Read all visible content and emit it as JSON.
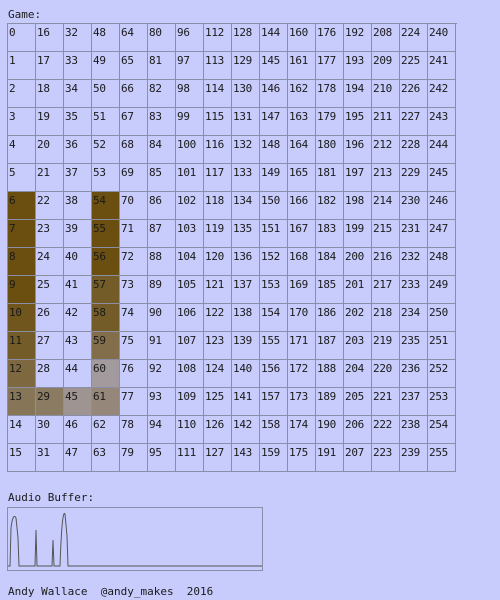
{
  "game": {
    "label": "Game:",
    "columns": 16,
    "rows": 16,
    "cells": [
      "0",
      "16",
      "32",
      "48",
      "64",
      "80",
      "96",
      "112",
      "128",
      "144",
      "160",
      "176",
      "192",
      "208",
      "224",
      "240",
      "1",
      "17",
      "33",
      "49",
      "65",
      "81",
      "97",
      "113",
      "129",
      "145",
      "161",
      "177",
      "193",
      "209",
      "225",
      "241",
      "2",
      "18",
      "34",
      "50",
      "66",
      "82",
      "98",
      "114",
      "130",
      "146",
      "162",
      "178",
      "194",
      "210",
      "226",
      "242",
      "3",
      "19",
      "35",
      "51",
      "67",
      "83",
      "99",
      "115",
      "131",
      "147",
      "163",
      "179",
      "195",
      "211",
      "227",
      "243",
      "4",
      "20",
      "36",
      "52",
      "68",
      "84",
      "100",
      "116",
      "132",
      "148",
      "164",
      "180",
      "196",
      "212",
      "228",
      "244",
      "5",
      "21",
      "37",
      "53",
      "69",
      "85",
      "101",
      "117",
      "133",
      "149",
      "165",
      "181",
      "197",
      "213",
      "229",
      "245",
      "6",
      "22",
      "38",
      "54",
      "70",
      "86",
      "102",
      "118",
      "134",
      "150",
      "166",
      "182",
      "198",
      "214",
      "230",
      "246",
      "7",
      "23",
      "39",
      "55",
      "71",
      "87",
      "103",
      "119",
      "135",
      "151",
      "167",
      "183",
      "199",
      "215",
      "231",
      "247",
      "8",
      "24",
      "40",
      "56",
      "72",
      "88",
      "104",
      "120",
      "136",
      "152",
      "168",
      "184",
      "200",
      "216",
      "232",
      "248",
      "9",
      "25",
      "41",
      "57",
      "73",
      "89",
      "105",
      "121",
      "137",
      "153",
      "169",
      "185",
      "201",
      "217",
      "233",
      "249",
      "10",
      "26",
      "42",
      "58",
      "74",
      "90",
      "106",
      "122",
      "138",
      "154",
      "170",
      "186",
      "202",
      "218",
      "234",
      "250",
      "11",
      "27",
      "43",
      "59",
      "75",
      "91",
      "107",
      "123",
      "139",
      "155",
      "171",
      "187",
      "203",
      "219",
      "235",
      "251",
      "12",
      "28",
      "44",
      "60",
      "76",
      "92",
      "108",
      "124",
      "140",
      "156",
      "172",
      "188",
      "204",
      "220",
      "236",
      "252",
      "13",
      "29",
      "45",
      "61",
      "77",
      "93",
      "109",
      "125",
      "141",
      "157",
      "173",
      "189",
      "205",
      "221",
      "237",
      "253",
      "14",
      "30",
      "46",
      "62",
      "78",
      "94",
      "110",
      "126",
      "142",
      "158",
      "174",
      "190",
      "206",
      "222",
      "238",
      "254",
      "15",
      "31",
      "47",
      "63",
      "79",
      "95",
      "111",
      "127",
      "143",
      "159",
      "175",
      "191",
      "207",
      "223",
      "239",
      "255"
    ],
    "highlighted": [
      {
        "value": 6,
        "shade": 1.0
      },
      {
        "value": 7,
        "shade": 1.0
      },
      {
        "value": 8,
        "shade": 1.0
      },
      {
        "value": 9,
        "shade": 1.0
      },
      {
        "value": 10,
        "shade": 0.95
      },
      {
        "value": 11,
        "shade": 0.9
      },
      {
        "value": 12,
        "shade": 0.8
      },
      {
        "value": 13,
        "shade": 0.7
      },
      {
        "value": 29,
        "shade": 0.65
      },
      {
        "value": 45,
        "shade": 0.45
      },
      {
        "value": 61,
        "shade": 0.55
      },
      {
        "value": 60,
        "shade": 0.4
      },
      {
        "value": 59,
        "shade": 0.75
      },
      {
        "value": 58,
        "shade": 0.9
      },
      {
        "value": 57,
        "shade": 0.9
      },
      {
        "value": 56,
        "shade": 1.0
      },
      {
        "value": 55,
        "shade": 1.0
      },
      {
        "value": 54,
        "shade": 1.0
      }
    ],
    "highlight_color": "#6b4f10",
    "grid_line_color": "#8a8ea6",
    "background_color": "#c8ccfc"
  },
  "audio": {
    "label": "Audio Buffer:",
    "waveform_color": "#555555"
  },
  "footer": {
    "text": "Andy Wallace  @andy_makes  2016"
  }
}
